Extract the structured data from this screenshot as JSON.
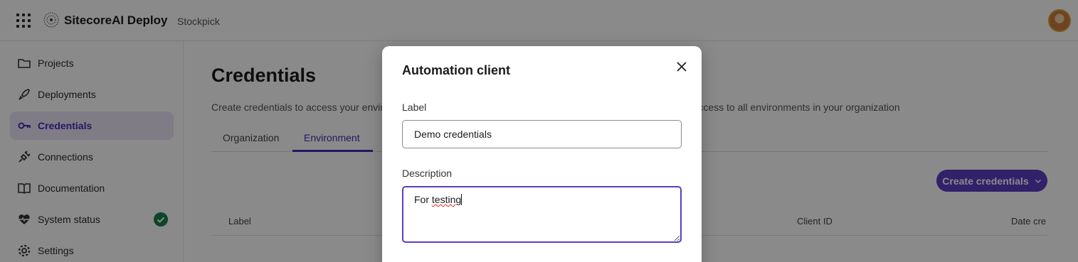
{
  "app": {
    "name": "SitecoreAI Deploy",
    "organization": "Stockpick",
    "icons": {
      "apps": "apps-grid-icon",
      "logo": "sitecore-logo-icon",
      "avatar": "user-avatar"
    }
  },
  "sidebar": {
    "items": [
      {
        "label": "Projects",
        "icon": "folder-icon",
        "active": false
      },
      {
        "label": "Deployments",
        "icon": "rocket-icon",
        "active": false
      },
      {
        "label": "Credentials",
        "icon": "key-icon",
        "active": true
      },
      {
        "label": "Connections",
        "icon": "plug-icon",
        "active": false
      },
      {
        "label": "Documentation",
        "icon": "book-icon",
        "active": false
      },
      {
        "label": "System status",
        "icon": "heartbeat-icon",
        "active": false,
        "status": "check-circle-icon"
      },
      {
        "label": "Settings",
        "icon": "gear-icon",
        "active": false
      }
    ]
  },
  "main": {
    "title": "Credentials",
    "description_left": "Create credentials to access your enviro",
    "description_right": "t access to all environments in your organization",
    "tabs": [
      {
        "label": "Organization",
        "active": false
      },
      {
        "label": "Environment",
        "active": true
      }
    ],
    "create_button": "Create credentials",
    "table": {
      "columns": [
        "Label",
        "Client ID",
        "Date cre"
      ]
    }
  },
  "modal": {
    "title": "Automation client",
    "label_field": {
      "label": "Label",
      "value": "Demo credentials"
    },
    "description_field": {
      "label": "Description",
      "value_prefix": "For ",
      "value_misspelled": "testing"
    }
  },
  "colors": {
    "accent": "#5b3cc4",
    "active_bg": "#ebe6f7",
    "status_ok": "#1b7f4e",
    "overlay": "rgba(0,0,0,0.46)"
  }
}
